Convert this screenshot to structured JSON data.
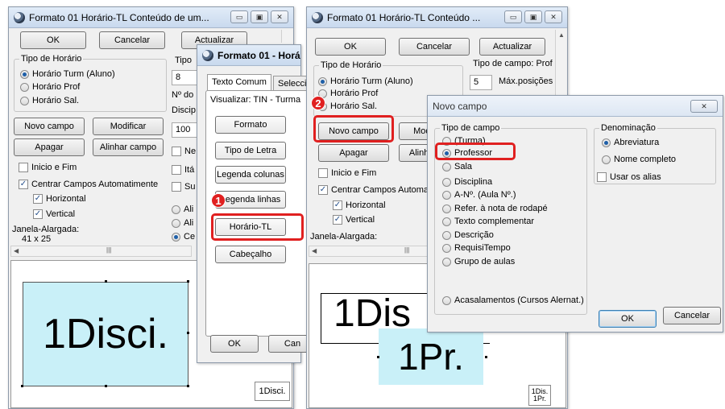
{
  "left_window": {
    "title": "Formato 01  Horário-TL  Conteúdo de um...",
    "ok": "OK",
    "cancelar": "Cancelar",
    "actualizar": "Actualizar",
    "tipo_horario_label": "Tipo de Horário",
    "radios": [
      "Horário Turm (Aluno)",
      "Horário Prof",
      "Horário Sal."
    ],
    "tipo_label": "Tipo",
    "tipo_value": "8",
    "n_do": "Nº do",
    "discip": "Discip",
    "discip_value": "100",
    "novo_campo": "Novo campo",
    "modificar": "Modificar",
    "apagar": "Apagar",
    "alinhar_campo": "Alinhar campo",
    "inicio_fim": "Inicio e Fim",
    "centrar": "Centrar Campos Automatimente",
    "horizontal": "Horizontal",
    "vertical": "Vertical",
    "ne": "Ne",
    "ita": "Itá",
    "su": "Su",
    "ali1": "Ali",
    "ali2": "Ali",
    "ce": "Ce",
    "janela": "Janela-Alargada:",
    "dims": "41 x 25",
    "cell_text": "1Disci.",
    "preview": "1Disci."
  },
  "mid_dialog": {
    "title": "Formato 01 - Horári",
    "tab1": "Texto Comum",
    "tab2": "Selecci",
    "visualizar": "Visualizar: TIN - Turma",
    "buttons": [
      "Formato",
      "Tipo de Letra",
      "Legenda colunas",
      "Legenda linhas",
      "Horário-TL",
      "Cabeçalho"
    ],
    "ok": "OK",
    "cancel": "Can"
  },
  "right_window": {
    "title": "Formato 01  Horário-TL  Conteúdo ...",
    "ok": "OK",
    "cancelar": "Cancelar",
    "actualizar": "Actualizar",
    "tipo_horario_label": "Tipo de Horário",
    "radios": [
      "Horário Turm (Aluno)",
      "Horário Prof",
      "Horário Sal."
    ],
    "tipo_campo": "Tipo de campo: Prof",
    "field_value": "5",
    "max_pos": "Máx.posições",
    "novo_campo": "Novo campo",
    "modi": "Modi",
    "apagar": "Apagar",
    "alinhar": "Alinhar",
    "inicio_fim": "Inicio e Fim",
    "centrar": "Centrar Campos Automat",
    "horizontal": "Horizontal",
    "vertical": "Vertical",
    "janela": "Janela-Alargada:",
    "cell_top": "1Dis",
    "cell_bottom": "1Pr.",
    "preview_top": "1Dis.",
    "preview_bottom": "1Pr."
  },
  "novo_dialog": {
    "title": "Novo campo",
    "tipo_label": "Tipo de campo",
    "options": [
      "(Turma)",
      "Professor",
      "Sala",
      "Disciplina",
      "A-Nº. (Aula Nº.)",
      "Refer. à nota de rodapé",
      "Texto complementar",
      "Descrição",
      "RequisiTempo",
      "Grupo de aulas",
      "Acasalamentos (Cursos Alernat.)"
    ],
    "denominacao": "Denominação",
    "den_options": [
      "Abreviatura",
      "Nome completo"
    ],
    "usar_alias": "Usar os alias",
    "ok": "OK",
    "cancelar": "Cancelar"
  },
  "badges": [
    "1",
    "2"
  ]
}
